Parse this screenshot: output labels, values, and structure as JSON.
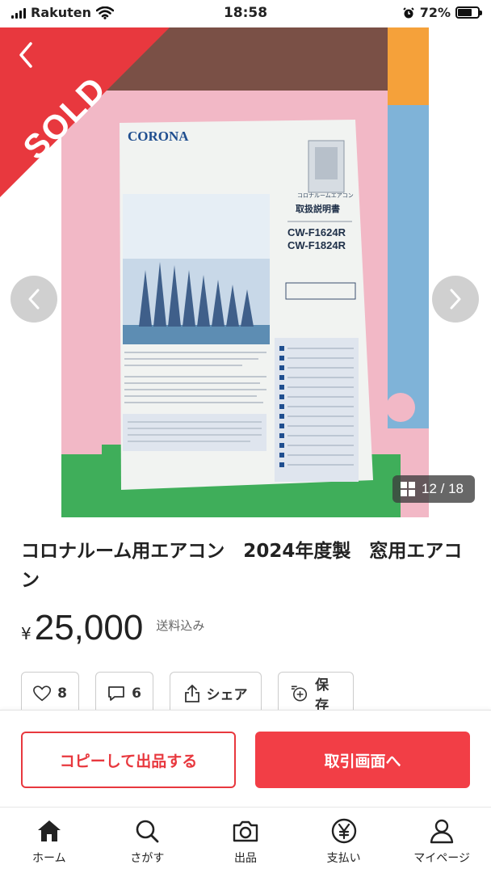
{
  "status_bar": {
    "carrier": "Rakuten",
    "time": "18:58",
    "battery": "72%",
    "battery_level": 0.72
  },
  "photo": {
    "sold_label": "SOLD",
    "counter": "12 / 18",
    "manual": {
      "brand": "CORONA",
      "subtitle": "コロナルームエアコン",
      "doc_title": "取扱説明書",
      "model_1": "CW-F1624R",
      "model_2": "CW-F1824R"
    }
  },
  "item": {
    "title": "コロナルーム用エアコン　2024年度製　窓用エアコン",
    "currency": "¥",
    "price": "25,000",
    "shipping": "送料込み"
  },
  "actions": {
    "like_count": "8",
    "comment_count": "6",
    "share_label": "シェア",
    "save_label": "保存"
  },
  "buttons": {
    "copy_label": "コピーして出品する",
    "trade_label": "取引画面へ"
  },
  "tabs": [
    {
      "label": "ホーム",
      "icon": "home-icon"
    },
    {
      "label": "さがす",
      "icon": "search-icon"
    },
    {
      "label": "出品",
      "icon": "camera-icon"
    },
    {
      "label": "支払い",
      "icon": "yen-icon"
    },
    {
      "label": "マイページ",
      "icon": "person-icon"
    }
  ],
  "colors": {
    "accent": "#e8383e",
    "sold_ribbon": "#e8383e"
  }
}
